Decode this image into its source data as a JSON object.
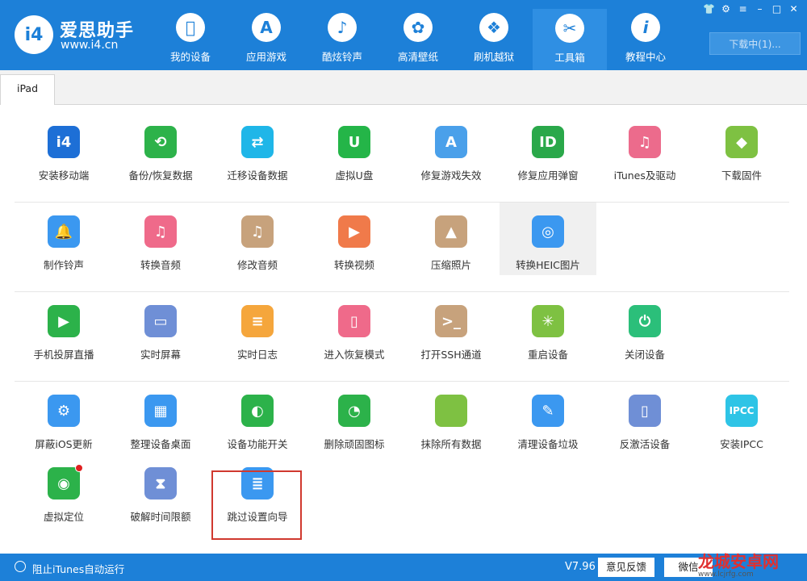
{
  "app": {
    "title": "爱思助手",
    "url": "www.i4.cn",
    "logo_text": "i4"
  },
  "nav": [
    {
      "label": "我的设备",
      "icon": "apple-icon"
    },
    {
      "label": "应用游戏",
      "icon": "app-store-icon"
    },
    {
      "label": "酷炫铃声",
      "icon": "bell-icon"
    },
    {
      "label": "高清壁纸",
      "icon": "flower-icon"
    },
    {
      "label": "刷机越狱",
      "icon": "dropbox-icon"
    },
    {
      "label": "工具箱",
      "icon": "tools-icon"
    },
    {
      "label": "教程中心",
      "icon": "info-icon"
    }
  ],
  "download_label": "下载中(1)...",
  "tab_label": "iPad",
  "tools": [
    [
      {
        "label": "安装移动端",
        "color": "#1d6fd6",
        "glyph": "i4"
      },
      {
        "label": "备份/恢复数据",
        "color": "#2db24a",
        "glyph": "⟲"
      },
      {
        "label": "迁移设备数据",
        "color": "#1fb6e8",
        "glyph": "⇄"
      },
      {
        "label": "虚拟U盘",
        "color": "#24b548",
        "glyph": "U"
      },
      {
        "label": "修复游戏失效",
        "color": "#4aa0ea",
        "glyph": "A"
      },
      {
        "label": "修复应用弹窗",
        "color": "#2aa84a",
        "glyph": "ID"
      },
      {
        "label": "iTunes及驱动",
        "color": "#ec6b8c",
        "glyph": "♫"
      },
      {
        "label": "下载固件",
        "color": "#7ec142",
        "glyph": "◆"
      }
    ],
    [
      {
        "label": "制作铃声",
        "color": "#3b98f0",
        "glyph": "🔔"
      },
      {
        "label": "转换音频",
        "color": "#ef6a8a",
        "glyph": "♫"
      },
      {
        "label": "修改音频",
        "color": "#c7a27c",
        "glyph": "♫"
      },
      {
        "label": "转换视频",
        "color": "#f07a4a",
        "glyph": "▶"
      },
      {
        "label": "压缩照片",
        "color": "#c7a27c",
        "glyph": "▲"
      },
      {
        "label": "转换HEIC图片",
        "color": "#3b98f0",
        "glyph": "◎"
      }
    ],
    [
      {
        "label": "手机投屏直播",
        "color": "#2cb24a",
        "glyph": "▶"
      },
      {
        "label": "实时屏幕",
        "color": "#6f8fd6",
        "glyph": "▭"
      },
      {
        "label": "实时日志",
        "color": "#f5a63c",
        "glyph": "≡"
      },
      {
        "label": "进入恢复模式",
        "color": "#ef6a8a",
        "glyph": "▯"
      },
      {
        "label": "打开SSH通道",
        "color": "#c7a27c",
        "glyph": ">_"
      },
      {
        "label": "重启设备",
        "color": "#7ec142",
        "glyph": "✳"
      },
      {
        "label": "关闭设备",
        "color": "#2bbf7a",
        "glyph": "⏻"
      }
    ],
    [
      {
        "label": "屏蔽iOS更新",
        "color": "#3b98f0",
        "glyph": "⚙"
      },
      {
        "label": "整理设备桌面",
        "color": "#3b98f0",
        "glyph": "▦"
      },
      {
        "label": "设备功能开关",
        "color": "#2cb24a",
        "glyph": "◐"
      },
      {
        "label": "删除顽固图标",
        "color": "#2cb24a",
        "glyph": "◔"
      },
      {
        "label": "抹除所有数据",
        "color": "#7ec142",
        "glyph": ""
      },
      {
        "label": "清理设备垃圾",
        "color": "#3b98f0",
        "glyph": "✎"
      },
      {
        "label": "反激活设备",
        "color": "#6f8fd6",
        "glyph": "▯"
      },
      {
        "label": "安装IPCC",
        "color": "#2ec4e6",
        "glyph": "IPCC"
      }
    ],
    [
      {
        "label": "虚拟定位",
        "color": "#2cb24a",
        "glyph": "◉"
      },
      {
        "label": "破解时间限额",
        "color": "#6f8fd6",
        "glyph": "⧗"
      },
      {
        "label": "跳过设置向导",
        "color": "#3b98f0",
        "glyph": "≣"
      }
    ]
  ],
  "footer": {
    "itunes_label": "阻止iTunes自动运行",
    "version": "V7.96",
    "feedback_label": "意见反馈",
    "wechat_label": "微信"
  },
  "watermark": {
    "title": "龙城安卓网",
    "url": "www.lcjrfg.com"
  }
}
